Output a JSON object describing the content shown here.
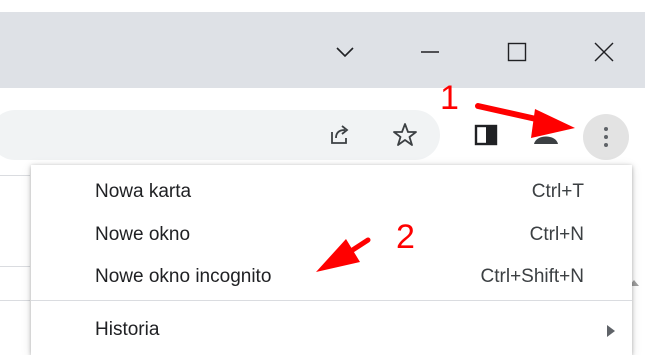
{
  "window_controls": {
    "tab_search": "tab-search",
    "minimize": "minimize",
    "maximize": "maximize",
    "close": "close"
  },
  "toolbar": {
    "share_icon": "share-icon",
    "star_icon": "star-icon",
    "side_panel_icon": "side-panel-icon",
    "profile_icon": "profile-icon",
    "menu_icon": "kebab-menu-icon"
  },
  "menu": {
    "items": [
      {
        "label": "Nowa karta",
        "shortcut": "Ctrl+T"
      },
      {
        "label": "Nowe okno",
        "shortcut": "Ctrl+N"
      },
      {
        "label": "Nowe okno incognito",
        "shortcut": "Ctrl+Shift+N"
      },
      {
        "label": "Historia",
        "shortcut": ""
      }
    ]
  },
  "annotations": {
    "step1": "1",
    "step2": "2",
    "color": "#ff0000"
  },
  "colors": {
    "titlebar": "#dee1e6",
    "omnibox": "#f1f3f4",
    "menu_button_bg": "#e3e3e3"
  }
}
